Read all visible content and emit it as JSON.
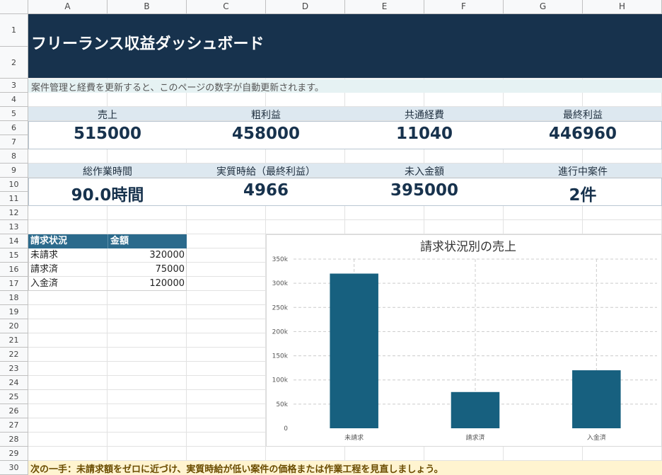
{
  "sheet": {
    "columns": [
      "A",
      "B",
      "C",
      "D",
      "E",
      "F",
      "G",
      "H"
    ],
    "rows": [
      "1",
      "2",
      "3",
      "4",
      "5",
      "6",
      "7",
      "8",
      "9",
      "10",
      "11",
      "12",
      "13",
      "14",
      "15",
      "16",
      "17",
      "18",
      "19",
      "20",
      "21",
      "22",
      "23",
      "24",
      "25",
      "26",
      "27",
      "28",
      "29",
      "30"
    ]
  },
  "header": {
    "title": "フリーランス収益ダッシュボード",
    "subtitle": "案件管理と経費を更新すると、このページの数字が自動更新されます。"
  },
  "kpi_row1": [
    {
      "label": "売上",
      "value": "515000"
    },
    {
      "label": "粗利益",
      "value": "458000"
    },
    {
      "label": "共通経費",
      "value": "11040"
    },
    {
      "label": "最終利益",
      "value": "446960"
    }
  ],
  "kpi_row2": [
    {
      "label": "総作業時間",
      "value": "90.0時間"
    },
    {
      "label": "実質時給（最終利益）",
      "value": "4966"
    },
    {
      "label": "未入金額",
      "value": "395000"
    },
    {
      "label": "進行中案件",
      "value": "2件"
    }
  ],
  "billing_table": {
    "headers": [
      "請求状況",
      "金額"
    ],
    "rows": [
      [
        "未請求",
        "320000"
      ],
      [
        "請求済",
        "75000"
      ],
      [
        "入金済",
        "120000"
      ]
    ]
  },
  "chart_data": {
    "type": "bar",
    "title": "請求状況別の売上",
    "categories": [
      "未請求",
      "請求済",
      "入金済"
    ],
    "values": [
      320000,
      75000,
      120000
    ],
    "ylim": [
      0,
      350000
    ],
    "yticks": [
      "0",
      "50k",
      "100k",
      "150k",
      "200k",
      "250k",
      "300k",
      "350k"
    ],
    "xlabel": "",
    "ylabel": "",
    "grid": true,
    "bar_color": "#17607f"
  },
  "footer": {
    "note": "次の一手：未請求額をゼロに近づけ、実質時給が低い案件の価格または作業工程を見直しましょう。"
  }
}
